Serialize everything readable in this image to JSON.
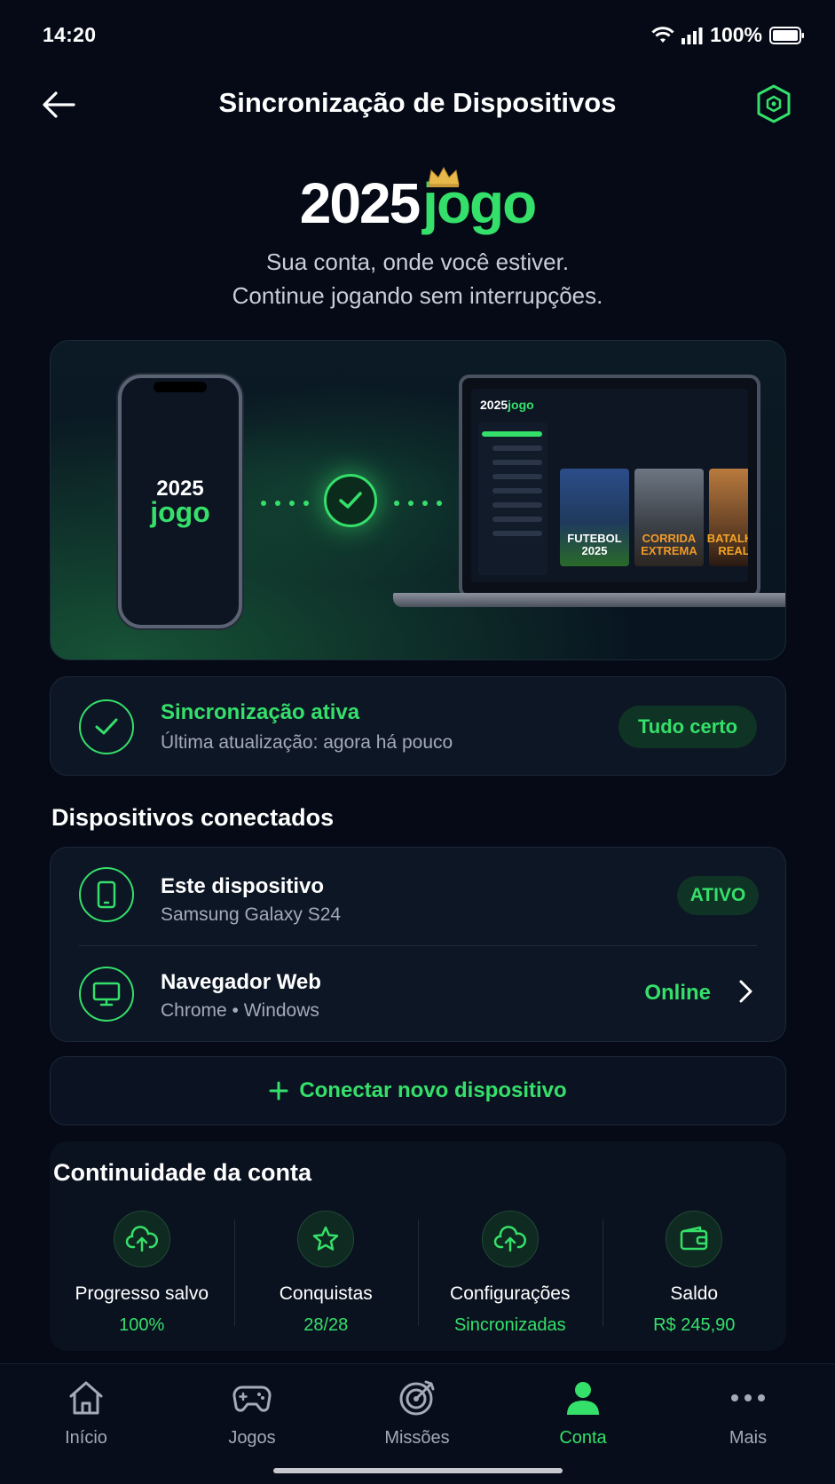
{
  "status": {
    "time": "14:20",
    "battery": "100%"
  },
  "header": {
    "title": "Sincronização de Dispositivos"
  },
  "brand": {
    "year": "2025",
    "name": "jogo",
    "tagline_1": "Sua conta, onde você estiver.",
    "tagline_2": "Continue jogando sem interrupções."
  },
  "hero": {
    "phone_logo_year": "2025",
    "phone_logo_name": "jogo",
    "laptop_logo_year": "2025",
    "laptop_logo_name": "jogo",
    "games": [
      "FUTEBOL 2025",
      "CORRIDA EXTREMA",
      "BATALHA REAL"
    ]
  },
  "sync": {
    "title": "Sincronização ativa",
    "subtitle": "Última atualização: agora há pouco",
    "badge": "Tudo certo"
  },
  "devices": {
    "section_title": "Dispositivos conectados",
    "items": [
      {
        "name": "Este dispositivo",
        "detail": "Samsung Galaxy S24",
        "status": "ATIVO",
        "icon": "smartphone-icon"
      },
      {
        "name": "Navegador Web",
        "detail": "Chrome • Windows",
        "status": "Online",
        "icon": "monitor-icon"
      }
    ]
  },
  "connect": {
    "label": "Conectar novo dispositivo"
  },
  "continuity": {
    "section_title": "Continuidade da conta",
    "items": [
      {
        "label": "Progresso salvo",
        "value": "100%",
        "icon": "cloud-upload-icon"
      },
      {
        "label": "Conquistas",
        "value": "28/28",
        "icon": "star-icon"
      },
      {
        "label": "Configurações",
        "value": "Sincronizadas",
        "icon": "cloud-upload-icon"
      },
      {
        "label": "Saldo",
        "value": "R$ 245,90",
        "icon": "wallet-icon"
      }
    ]
  },
  "nav": {
    "items": [
      {
        "label": "Início",
        "icon": "home-icon"
      },
      {
        "label": "Jogos",
        "icon": "gamepad-icon"
      },
      {
        "label": "Missões",
        "icon": "target-icon"
      },
      {
        "label": "Conta",
        "icon": "user-icon",
        "active": true
      },
      {
        "label": "Mais",
        "icon": "more-icon"
      }
    ]
  },
  "colors": {
    "accent": "#35e06a",
    "background": "#050a16",
    "card": "#0d1625",
    "gold": "#e8b84a"
  }
}
